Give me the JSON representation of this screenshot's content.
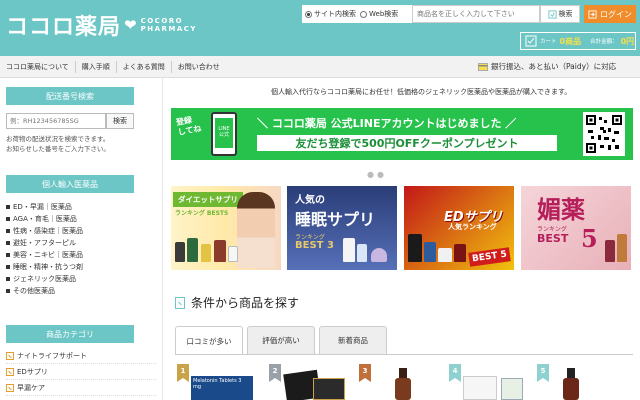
{
  "header": {
    "logo_jp": "ココロ薬局",
    "logo_en_line1": "COCORO",
    "logo_en_line2": "PHARMACY",
    "search_options": [
      "サイト内検索",
      "Web検索"
    ],
    "search_placeholder": "商品名を正しく入力して下さい",
    "search_button": "検索",
    "login_button": "ログイン",
    "cart_label": "カート",
    "cart_count": "0商品",
    "cart_total_label": "合計金額：",
    "cart_total": "0円"
  },
  "nav": {
    "items": [
      "ココロ薬局について",
      "購入手順",
      "よくある質問",
      "お問い合わせ"
    ],
    "notice": "銀行振込、あと払い（Paidy）に対応"
  },
  "sidebar": {
    "tracking_heading": "配送番号検索",
    "tracking_placeholder": "例：RH123456785SG",
    "tracking_button": "検索",
    "tracking_note_1": "お荷物の配送状況を検索できます。",
    "tracking_note_2": "お知らせした番号をご入力下さい。",
    "import_heading": "個人輸入医薬品",
    "import_items": [
      "ED・早漏｜医薬品",
      "AGA・育毛｜医薬品",
      "性病・感染症｜医薬品",
      "避妊・アフターピル",
      "美容・ニキビ｜医薬品",
      "睡眠・精神・抗うつ剤",
      "ジェネリック医薬品",
      "その他医薬品"
    ],
    "category_heading": "商品カテゴリ",
    "category_items": [
      "ナイトライフサポート",
      "EDサプリ",
      "早漏ケア"
    ]
  },
  "main": {
    "intro": "個人輸入代行ならココロ薬局にお任せ！低価格のジェネリック医薬品や医薬品が購入できます。",
    "line_banner": {
      "left_text_1": "登録",
      "left_text_2": "してね",
      "phone_text_1": "LINE",
      "phone_text_2": "公式",
      "headline": "＼ ココロ薬局 公式LINEアカウントはじめました ／",
      "subline": "友だち登録で500円OFFクーポンプレゼント"
    },
    "promos": [
      {
        "title": "ダイエットサプリ",
        "subtitle": "ランキング BEST5"
      },
      {
        "line1": "人気の",
        "line2": "睡眠サプリ",
        "line3": "ランキング",
        "best": "BEST 3"
      },
      {
        "title": "EDサプリ",
        "subtitle": "人気ランキング",
        "badge": "BEST 5"
      },
      {
        "title": "媚薬",
        "subtitle": "ランキング",
        "best": "BEST",
        "num": "5"
      }
    ],
    "section_title": "条件から商品を探す",
    "tabs": [
      "口コミが多い",
      "評価が高い",
      "新着商品"
    ],
    "product_ranks": [
      "1",
      "2",
      "3",
      "4",
      "5"
    ],
    "product_label_1": "Melatonin Tablets 3 mg"
  },
  "colors": {
    "teal": "#6cc6c6",
    "orange": "#f08c2a",
    "line_green": "#27c24c"
  }
}
